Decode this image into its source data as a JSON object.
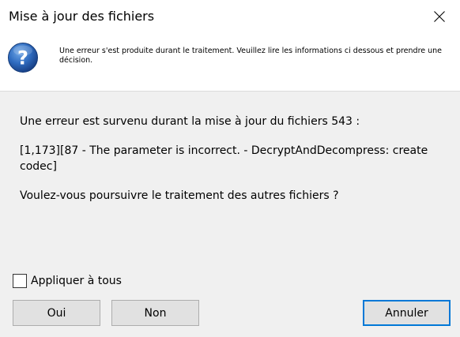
{
  "window": {
    "title": "Mise à jour des fichiers"
  },
  "header": {
    "icon": "question-icon",
    "message": "Une erreur s'est produite durant le traitement. Veuillez lire les informations ci dessous et prendre une décision."
  },
  "body": {
    "line1": "Une erreur est survenu durant la mise à jour du fichiers 543 :",
    "line2": "[1,173][87 - The parameter is incorrect. - DecryptAndDecompress: create codec]",
    "line3": "Voulez-vous poursuivre le traitement des autres fichiers ?"
  },
  "options": {
    "apply_all_label": "Appliquer à tous",
    "apply_all_checked": false
  },
  "buttons": {
    "yes": "Oui",
    "no": "Non",
    "cancel": "Annuler"
  },
  "colors": {
    "accent": "#0078d7",
    "icon_blue": "#1f5fa8"
  }
}
